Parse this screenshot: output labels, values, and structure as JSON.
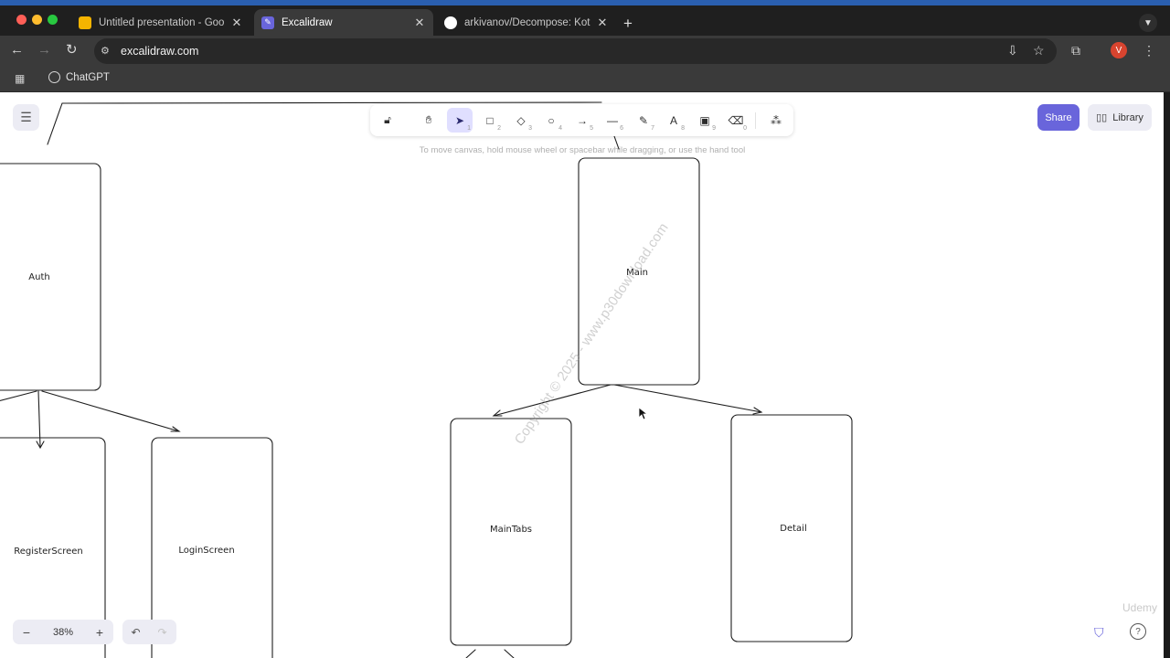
{
  "browser": {
    "tabs": [
      {
        "title": "Untitled presentation - Google Slides",
        "active": false
      },
      {
        "title": "Excalidraw",
        "active": true
      },
      {
        "title": "arkivanov/Decompose: Kotlin",
        "active": false
      }
    ],
    "url": "excalidraw.com",
    "profile_initial": "V",
    "bookmarks": [
      {
        "label": "ChatGPT"
      }
    ]
  },
  "excalidraw": {
    "tools": [
      {
        "name": "lock",
        "key": ""
      },
      {
        "name": "hand",
        "key": ""
      },
      {
        "name": "selection",
        "key": "1",
        "selected": true
      },
      {
        "name": "rectangle",
        "key": "2"
      },
      {
        "name": "diamond",
        "key": "3"
      },
      {
        "name": "ellipse",
        "key": "4"
      },
      {
        "name": "arrow",
        "key": "5"
      },
      {
        "name": "line",
        "key": "6"
      },
      {
        "name": "draw",
        "key": "7"
      },
      {
        "name": "text",
        "key": "8"
      },
      {
        "name": "image",
        "key": "9"
      },
      {
        "name": "eraser",
        "key": "0"
      },
      {
        "name": "extra-tools",
        "key": ""
      }
    ],
    "hint": "To move canvas, hold mouse wheel or spacebar while dragging, or use the hand tool",
    "share_label": "Share",
    "library_label": "Library",
    "zoom": "38%",
    "canvas": {
      "nodes": {
        "auth": "Auth",
        "main": "Main",
        "register": "RegisterScreen",
        "login": "LoginScreen",
        "maintabs": "MainTabs",
        "detail": "Detail"
      }
    },
    "watermark": "Copyright © 2025 - www.p30download.com",
    "udemy_mark": "Udemy"
  },
  "colors": {
    "accent": "#6965db",
    "selected_tool_bg": "#e0dfff",
    "island_bg": "#ececf4",
    "stroke": "#1e1e1e"
  }
}
